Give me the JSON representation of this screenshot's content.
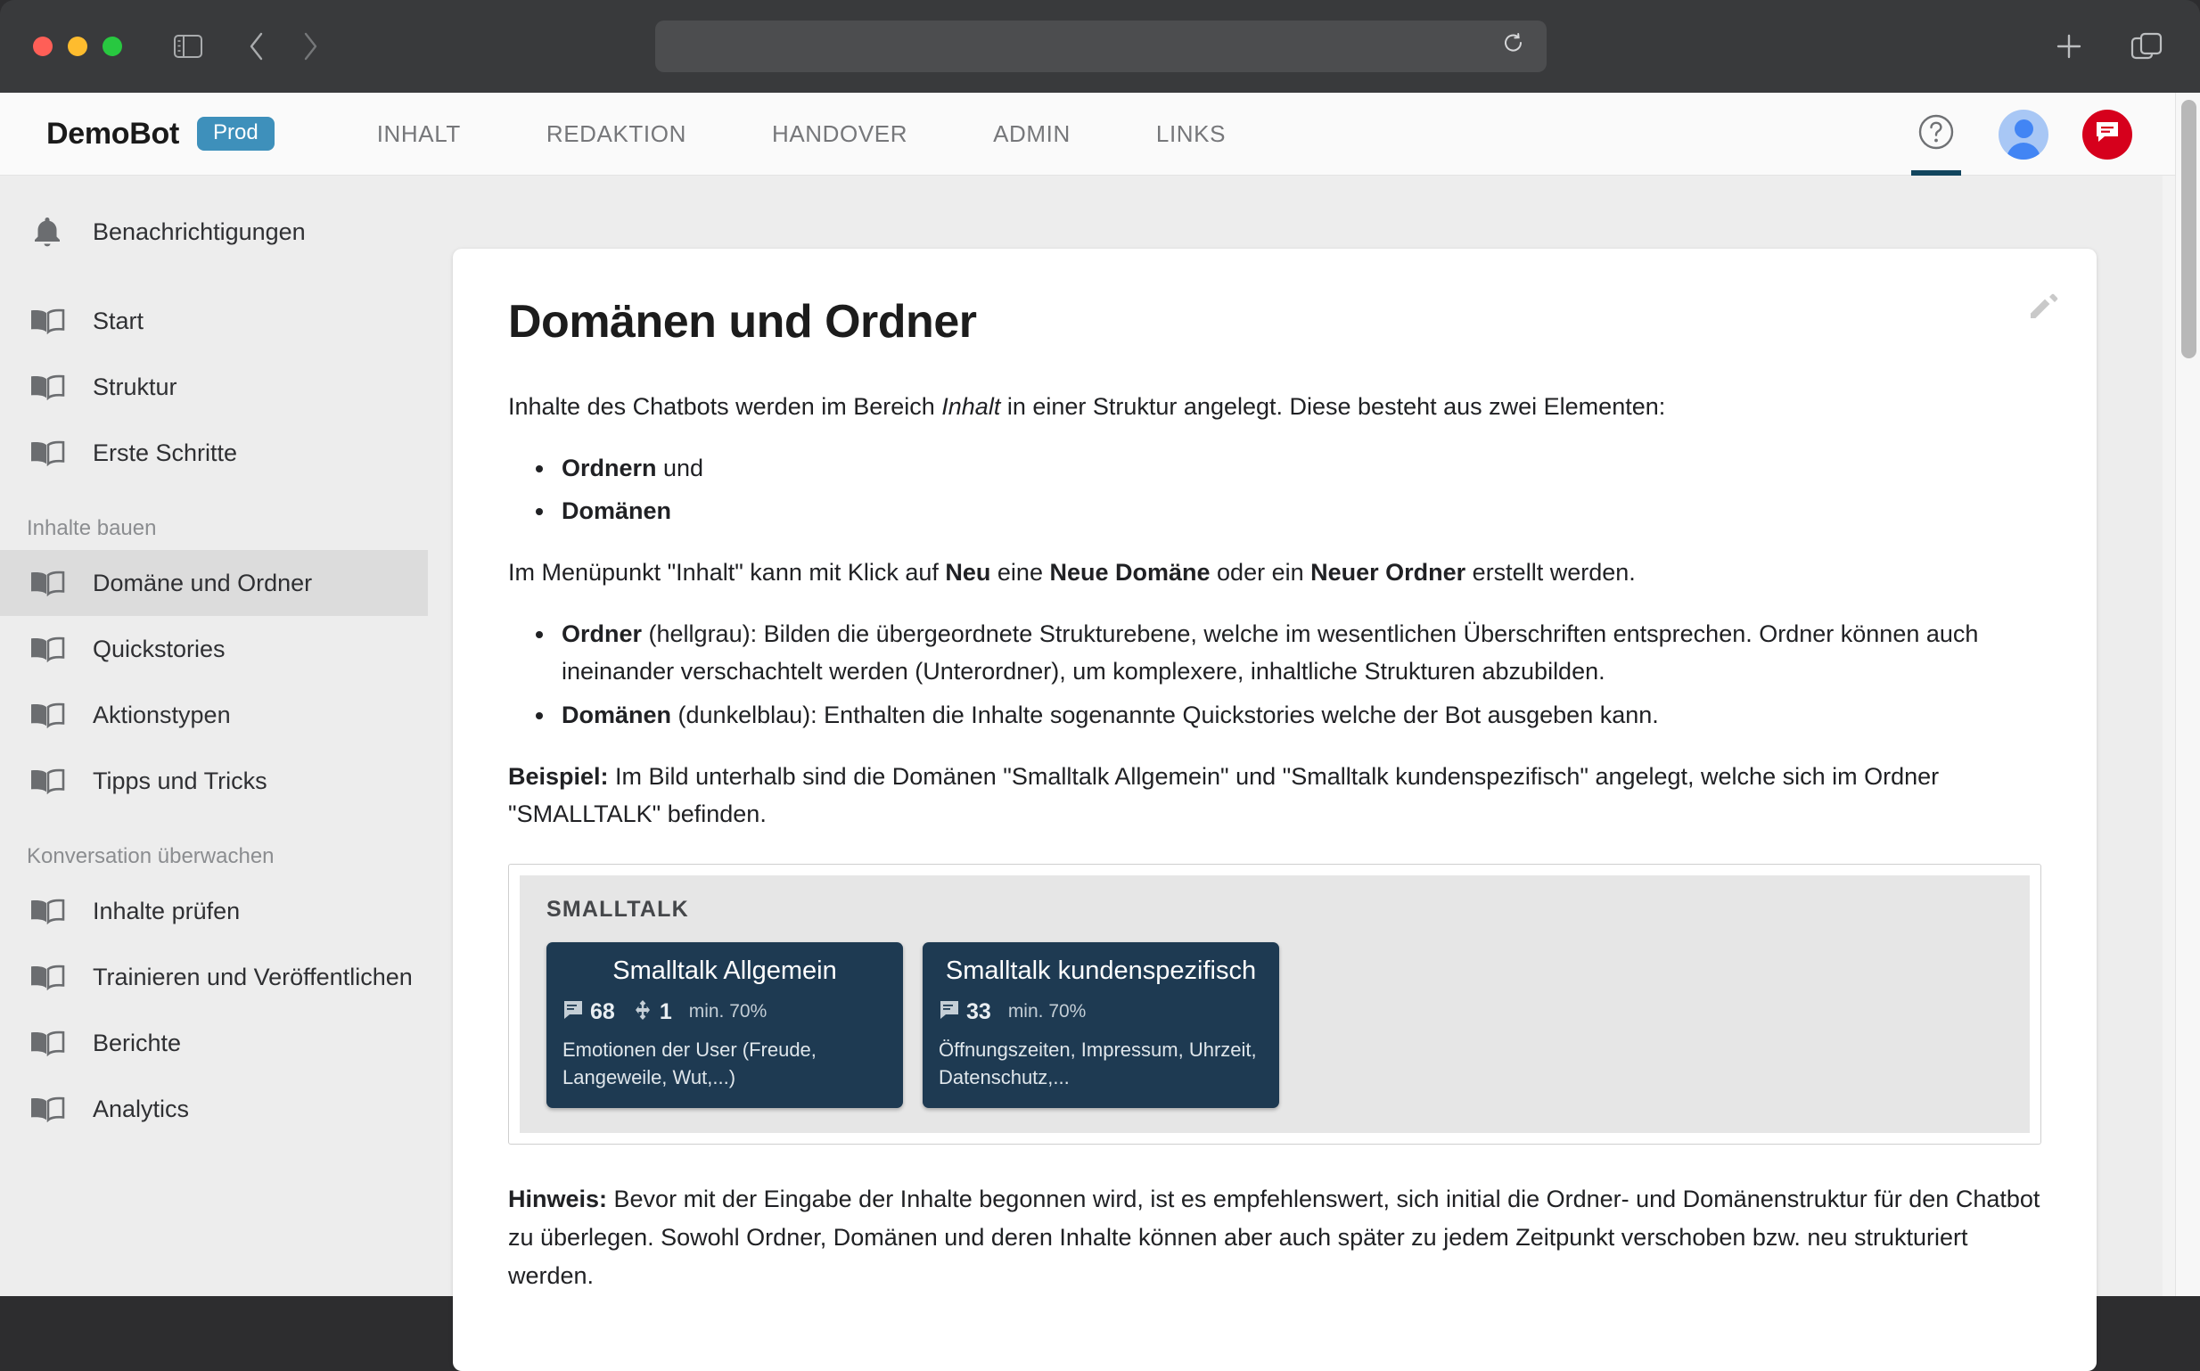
{
  "browser": {
    "url_value": "",
    "url_placeholder": "",
    "reload_icon": "reload-icon",
    "sidebar_toggle_icon": "sidebar-toggle-icon",
    "back_icon": "chevron-left-icon",
    "forward_icon": "chevron-right-icon",
    "new_tab_icon": "plus-icon",
    "tab_overview_icon": "tab-overview-icon"
  },
  "header": {
    "brand": "DemoBot",
    "env_badge": "Prod",
    "env_badge_color": "#3e90bb",
    "nav": [
      {
        "label": "INHALT"
      },
      {
        "label": "REDAKTION"
      },
      {
        "label": "HANDOVER"
      },
      {
        "label": "ADMIN"
      },
      {
        "label": "LINKS"
      }
    ],
    "help_icon": "help-circle-icon",
    "avatar_icon": "user-avatar-icon",
    "chat_icon": "chat-bubble-icon",
    "chat_color": "#d6001c",
    "active_indicator_color": "#11455e"
  },
  "sidebar": {
    "notifications": {
      "label": "Benachrichtigungen",
      "icon": "bell-icon"
    },
    "top_items": [
      {
        "label": "Start",
        "icon": "book-icon"
      },
      {
        "label": "Struktur",
        "icon": "book-icon"
      },
      {
        "label": "Erste Schritte",
        "icon": "book-icon"
      }
    ],
    "section_build": "Inhalte bauen",
    "build_items": [
      {
        "label": "Domäne und Ordner",
        "icon": "book-icon",
        "selected": true
      },
      {
        "label": "Quickstories",
        "icon": "book-icon",
        "selected": false
      },
      {
        "label": "Aktionstypen",
        "icon": "book-icon",
        "selected": false
      },
      {
        "label": "Tipps und Tricks",
        "icon": "book-icon",
        "selected": false
      }
    ],
    "section_monitor": "Konversation überwachen",
    "monitor_items": [
      {
        "label": "Inhalte prüfen",
        "icon": "book-icon"
      },
      {
        "label": "Trainieren und Veröffentlichen",
        "icon": "book-icon"
      },
      {
        "label": "Berichte",
        "icon": "book-icon"
      },
      {
        "label": "Analytics",
        "icon": "book-icon"
      }
    ]
  },
  "content": {
    "title": "Domänen und Ordner",
    "edit_icon": "pencil-edit-icon",
    "p1_a": "Inhalte des Chatbots werden im Bereich ",
    "p1_em": "Inhalt",
    "p1_b": " in einer Struktur angelegt. Diese besteht aus zwei Elementen:",
    "list1": [
      {
        "bold": "Ordnern",
        "rest": " und"
      },
      {
        "bold": "Domänen",
        "rest": ""
      }
    ],
    "p2_a": "Im Menüpunkt \"Inhalt\" kann mit Klick auf ",
    "p2_b1": "Neu",
    "p2_b": " eine ",
    "p2_b2": "Neue Domäne",
    "p2_c": " oder ein ",
    "p2_b3": "Neuer Ordner",
    "p2_d": " erstellt werden.",
    "list2": [
      {
        "bold": "Ordner",
        "rest": " (hellgrau): Bilden die übergeordnete Strukturebene, welche im wesentlichen Überschriften entsprechen. Ordner können auch ineinander verschachtelt werden (Unterordner), um komplexere, inhaltliche Strukturen abzubilden."
      },
      {
        "bold": "Domänen",
        "rest": " (dunkelblau): Enthalten die Inhalte sogenannte Quickstories welche der Bot ausgeben kann."
      }
    ],
    "p3_bold": "Beispiel:",
    "p3_rest": " Im Bild unterhalb sind die Domänen \"Smalltalk Allgemein\" und \"Smalltalk kundenspezifisch\" angelegt, welche sich im Ordner \"SMALLTALK\" befinden.",
    "p4_bold": "Hinweis:",
    "p4_rest": " Bevor mit der Eingabe der Inhalte begonnen wird, ist es empfehlenswert, sich initial die Ordner- und Domänenstruktur für den Chatbot zu überlegen. Sowohl Ordner, Domänen und deren Inhalte können aber auch später zu jedem Zeitpunkt verschoben bzw. neu strukturiert werden."
  },
  "diagram": {
    "folder_label": "SMALLTALK",
    "folder_color": "#e6e6e6",
    "domain_color": "#1e3a52",
    "cards": [
      {
        "title": "Smalltalk Allgemein",
        "quickstory_icon": "message-lines-icon",
        "quickstory_count": "68",
        "action_icon": "device-hub-icon",
        "action_count": "1",
        "threshold": "min. 70%",
        "description": "Emotionen der User (Freude, Langeweile, Wut,...)"
      },
      {
        "title": "Smalltalk kundenspezifisch",
        "quickstory_icon": "message-lines-icon",
        "quickstory_count": "33",
        "action_icon": "",
        "action_count": "",
        "threshold": "min. 70%",
        "description": "Öffnungszeiten, Impressum, Uhrzeit, Datenschutz,..."
      }
    ]
  }
}
